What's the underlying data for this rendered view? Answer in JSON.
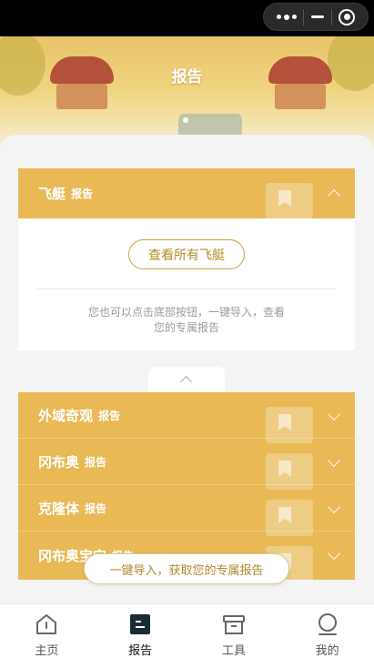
{
  "banner": {
    "title": "报告"
  },
  "sections": [
    {
      "name": "飞艇",
      "sub": "报告",
      "expanded": true,
      "button": "查看所有飞艇",
      "hint_line1": "您也可以点击底部按钮，一键导入，查看",
      "hint_line2": "您的专属报告"
    },
    {
      "name": "外域奇观",
      "sub": "报告"
    },
    {
      "name": "冈布奥",
      "sub": "报告"
    },
    {
      "name": "克隆体",
      "sub": "报告"
    },
    {
      "name": "冈布奥宝宝",
      "sub": "报告"
    }
  ],
  "import_button": "一键导入，获取您的专属报告",
  "tabbar": [
    {
      "label": "主页",
      "icon": "home-icon"
    },
    {
      "label": "报告",
      "icon": "report-icon"
    },
    {
      "label": "工具",
      "icon": "toolbox-icon"
    },
    {
      "label": "我的",
      "icon": "profile-icon"
    }
  ],
  "colors": {
    "accent": "#e8b955",
    "button_text": "#b58d27",
    "tab_active": "#1a1a1a"
  }
}
